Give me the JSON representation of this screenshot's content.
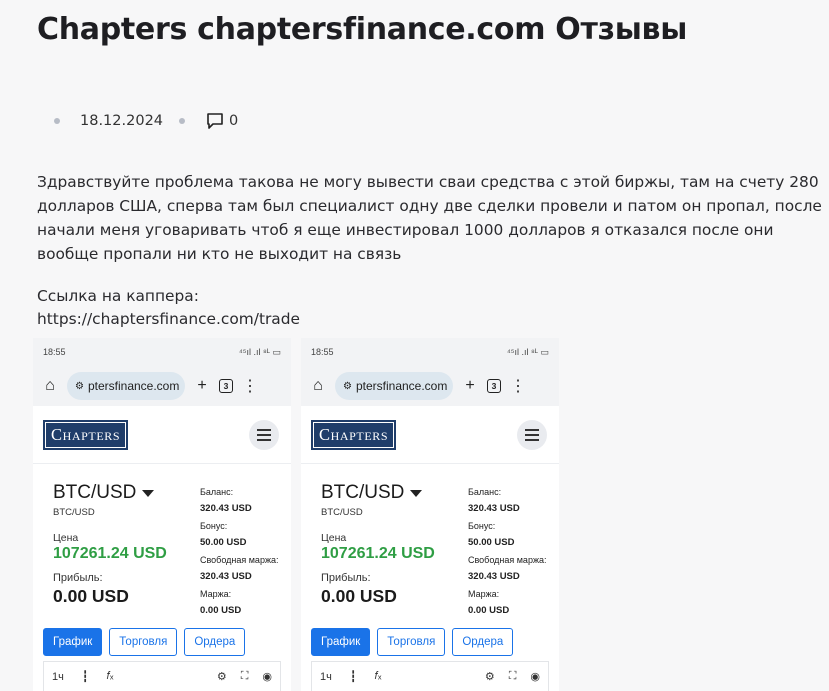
{
  "post": {
    "title": "Chapters chaptersfinance.com Отзывы",
    "date": "18.12.2024",
    "comment_count": "0",
    "body": "Здравствуйте проблема такова не могу вывести сваи средства с этой биржы, там на счету 280 долларов США, сперва там был специалист одну две сделки провели и патом он пропал, после начали меня уговаривать чтоб я еще инвестировал 1000 долларов я отказался после они вообще пропали ни кто не выходит на связь",
    "link_label": "Ссылка на каппера:",
    "link_url": "https://chaptersfinance.com/trade"
  },
  "screenshot": {
    "status_time": "18:55",
    "status_right": "⁴⁵ıl .ıl ⁸ᴸ ▭",
    "url": "ptersfinance.com",
    "tab_count": "3",
    "logo": "Chapters",
    "pair": "BTC/USD",
    "pair_sub": "BTC/USD",
    "price_label": "Цена",
    "price": "107261.24 USD",
    "profit_label": "Прибыль:",
    "profit": "0.00 USD",
    "balance_label": "Баланс:",
    "balance": "320.43 USD",
    "bonus_label": "Бонус:",
    "bonus": "50.00 USD",
    "free_margin_label": "Свободная маржа:",
    "free_margin": "320.43 USD",
    "margin_label": "Маржа:",
    "margin": "0.00 USD",
    "btn_chart": "График",
    "btn_trade": "Торговля",
    "btn_orders": "Ордера",
    "timeframe": "1ч",
    "fx": "𝑓ₓ"
  },
  "colors": {
    "price_green": "#2f9e44",
    "button_blue": "#1a73e8",
    "logo_navy": "#1f3d6a"
  }
}
